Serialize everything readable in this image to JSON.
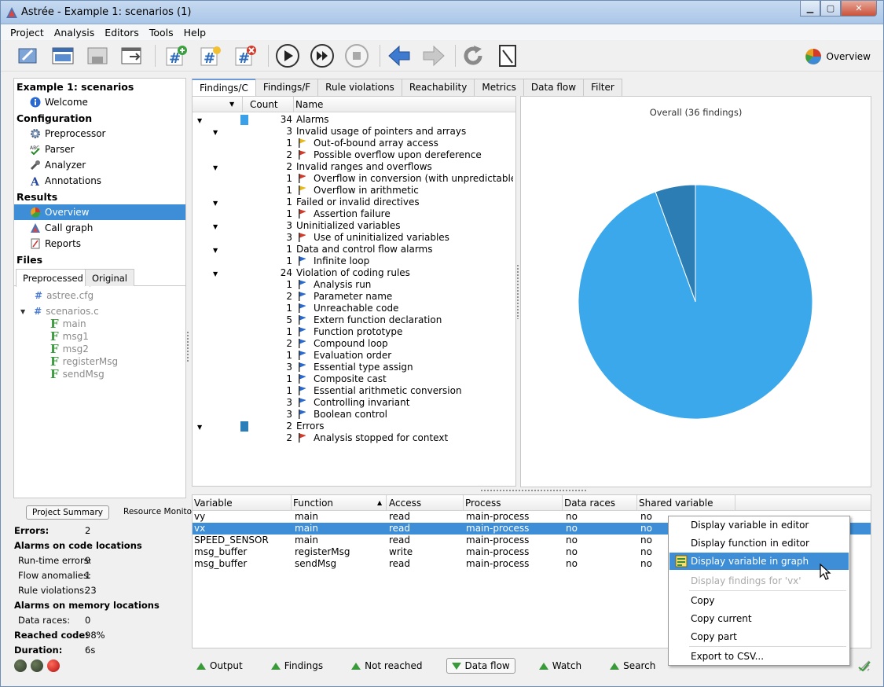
{
  "window": {
    "title": "Astrée - Example 1: scenarios (1)"
  },
  "menu": [
    "Project",
    "Analysis",
    "Editors",
    "Tools",
    "Help"
  ],
  "toolbar": {
    "overview_label": "Overview"
  },
  "nav": {
    "project": "Example 1: scenarios",
    "welcome": "Welcome",
    "configuration": "Configuration",
    "preprocessor": "Preprocessor",
    "parser": "Parser",
    "analyzer": "Analyzer",
    "annotations": "Annotations",
    "results": "Results",
    "overview": "Overview",
    "callgraph": "Call graph",
    "reports": "Reports",
    "files": "Files",
    "tab_pre": "Preprocessed",
    "tab_orig": "Original",
    "cfg": "astree.cfg",
    "c": "scenarios.c",
    "funcs": [
      "main",
      "msg1",
      "msg2",
      "registerMsg",
      "sendMsg"
    ]
  },
  "summary": {
    "tab_project": "Project Summary",
    "tab_resource": "Resource Monitor",
    "errors_label": "Errors:",
    "errors": "2",
    "alarms_code": "Alarms on code locations",
    "rte_label": "Run-time errors:",
    "rte": "9",
    "flow_label": "Flow anomalies:",
    "flow": "1",
    "rule_label": "Rule violations:",
    "rule": "23",
    "alarms_mem": "Alarms on memory locations",
    "dr_label": "Data races:",
    "dr": "0",
    "reached_label": "Reached code:",
    "reached": "98%",
    "duration_label": "Duration:",
    "duration": "6s"
  },
  "tabs": [
    "Findings/C",
    "Findings/F",
    "Rule violations",
    "Reachability",
    "Metrics",
    "Data flow",
    "Filter"
  ],
  "findings": {
    "col_count": "Count",
    "col_name": "Name",
    "rows": [
      {
        "c": "34",
        "n": "Alarms",
        "lvl": 0,
        "bar": "#3aa0e8"
      },
      {
        "c": "3",
        "n": "Invalid usage of pointers and arrays",
        "lvl": 1
      },
      {
        "c": "1",
        "n": "Out-of-bound array access",
        "lvl": 2,
        "flag": "yellow"
      },
      {
        "c": "2",
        "n": "Possible overflow upon dereference",
        "lvl": 2,
        "flag": "red"
      },
      {
        "c": "2",
        "n": "Invalid ranges and overflows",
        "lvl": 1
      },
      {
        "c": "1",
        "n": "Overflow in conversion (with unpredictable re...",
        "lvl": 2,
        "flag": "red"
      },
      {
        "c": "1",
        "n": "Overflow in arithmetic",
        "lvl": 2,
        "flag": "yellow"
      },
      {
        "c": "1",
        "n": "Failed or invalid directives",
        "lvl": 1
      },
      {
        "c": "1",
        "n": "Assertion failure",
        "lvl": 2,
        "flag": "red"
      },
      {
        "c": "3",
        "n": "Uninitialized variables",
        "lvl": 1
      },
      {
        "c": "3",
        "n": "Use of uninitialized variables",
        "lvl": 2,
        "flag": "red"
      },
      {
        "c": "1",
        "n": "Data and control flow alarms",
        "lvl": 1
      },
      {
        "c": "1",
        "n": "Infinite loop",
        "lvl": 2,
        "flag": "blue"
      },
      {
        "c": "24",
        "n": "Violation of coding rules",
        "lvl": 1
      },
      {
        "c": "1",
        "n": "Analysis run",
        "lvl": 2,
        "flag": "blue"
      },
      {
        "c": "2",
        "n": "Parameter name",
        "lvl": 2,
        "flag": "blue"
      },
      {
        "c": "1",
        "n": "Unreachable code",
        "lvl": 2,
        "flag": "blue"
      },
      {
        "c": "5",
        "n": "Extern function declaration",
        "lvl": 2,
        "flag": "blue"
      },
      {
        "c": "1",
        "n": "Function prototype",
        "lvl": 2,
        "flag": "blue"
      },
      {
        "c": "2",
        "n": "Compound loop",
        "lvl": 2,
        "flag": "blue"
      },
      {
        "c": "1",
        "n": "Evaluation order",
        "lvl": 2,
        "flag": "blue"
      },
      {
        "c": "3",
        "n": "Essential type assign",
        "lvl": 2,
        "flag": "blue"
      },
      {
        "c": "1",
        "n": "Composite cast",
        "lvl": 2,
        "flag": "blue"
      },
      {
        "c": "1",
        "n": "Essential arithmetic conversion",
        "lvl": 2,
        "flag": "blue"
      },
      {
        "c": "3",
        "n": "Controlling invariant",
        "lvl": 2,
        "flag": "blue"
      },
      {
        "c": "3",
        "n": "Boolean control",
        "lvl": 2,
        "flag": "blue"
      },
      {
        "c": "2",
        "n": "Errors",
        "lvl": 0,
        "bar": "#2a7fb8"
      },
      {
        "c": "2",
        "n": "Analysis stopped for context",
        "lvl": 2,
        "flag": "red"
      }
    ]
  },
  "chart_data": {
    "type": "pie",
    "title": "Overall (36 findings)",
    "categories": [
      "Alarms",
      "Errors"
    ],
    "values": [
      34,
      2
    ],
    "colors": [
      "#3aa8ea",
      "#2b7db4"
    ]
  },
  "vars": {
    "headers": [
      "Variable",
      "Function",
      "Access",
      "Process",
      "Data races",
      "Shared variable"
    ],
    "rows": [
      [
        "vy",
        "main",
        "read",
        "main-process",
        "no",
        "no"
      ],
      [
        "vx",
        "main",
        "read",
        "main-process",
        "no",
        "no"
      ],
      [
        "SPEED_SENSOR",
        "main",
        "read",
        "main-process",
        "no",
        "no"
      ],
      [
        "msg_buffer",
        "registerMsg",
        "write",
        "main-process",
        "no",
        "no"
      ],
      [
        "msg_buffer",
        "sendMsg",
        "read",
        "main-process",
        "no",
        "no"
      ]
    ]
  },
  "bottom": [
    "Output",
    "Findings",
    "Not reached",
    "Data flow",
    "Watch",
    "Search"
  ],
  "context_menu": {
    "items": [
      "Display variable in editor",
      "Display function in editor",
      "Display variable in graph",
      "Display findings for 'vx'",
      "Copy",
      "Copy current",
      "Copy part",
      "Export to CSV..."
    ]
  }
}
